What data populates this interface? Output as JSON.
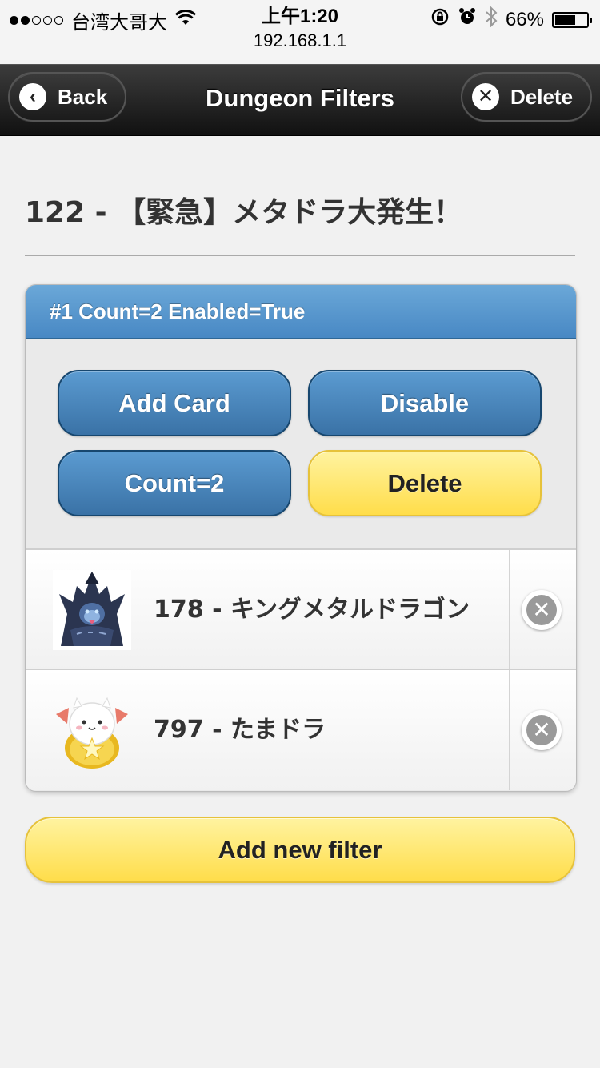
{
  "status_bar": {
    "carrier": "台湾大哥大",
    "time": "上午1:20",
    "url": "192.168.1.1",
    "battery_text": "66%",
    "battery_level": 0.66,
    "signal_bars_filled": 2,
    "signal_bars_total": 5
  },
  "navbar": {
    "title": "Dungeon Filters",
    "back_label": "Back",
    "back_icon": "‹",
    "delete_label": "Delete",
    "delete_icon": "✕"
  },
  "dungeon": {
    "title": "122 - 【緊急】メタドラ大発生！"
  },
  "filter": {
    "header": "#1 Count=2 Enabled=True",
    "buttons": {
      "add_card": "Add Card",
      "disable": "Disable",
      "count": "Count=2",
      "delete": "Delete"
    },
    "cards": [
      {
        "label": "178 - キングメタルドラゴン",
        "icon": "king-metal-dragon-icon"
      },
      {
        "label": "797 - たまドラ",
        "icon": "tamadra-icon"
      }
    ],
    "remove_icon": "✕"
  },
  "add_filter_label": "Add new filter",
  "colors": {
    "header_blue": "#4888c4",
    "button_blue": "#3a72a6",
    "button_yellow": "#ffdd4a",
    "nav_dark": "#111111"
  }
}
